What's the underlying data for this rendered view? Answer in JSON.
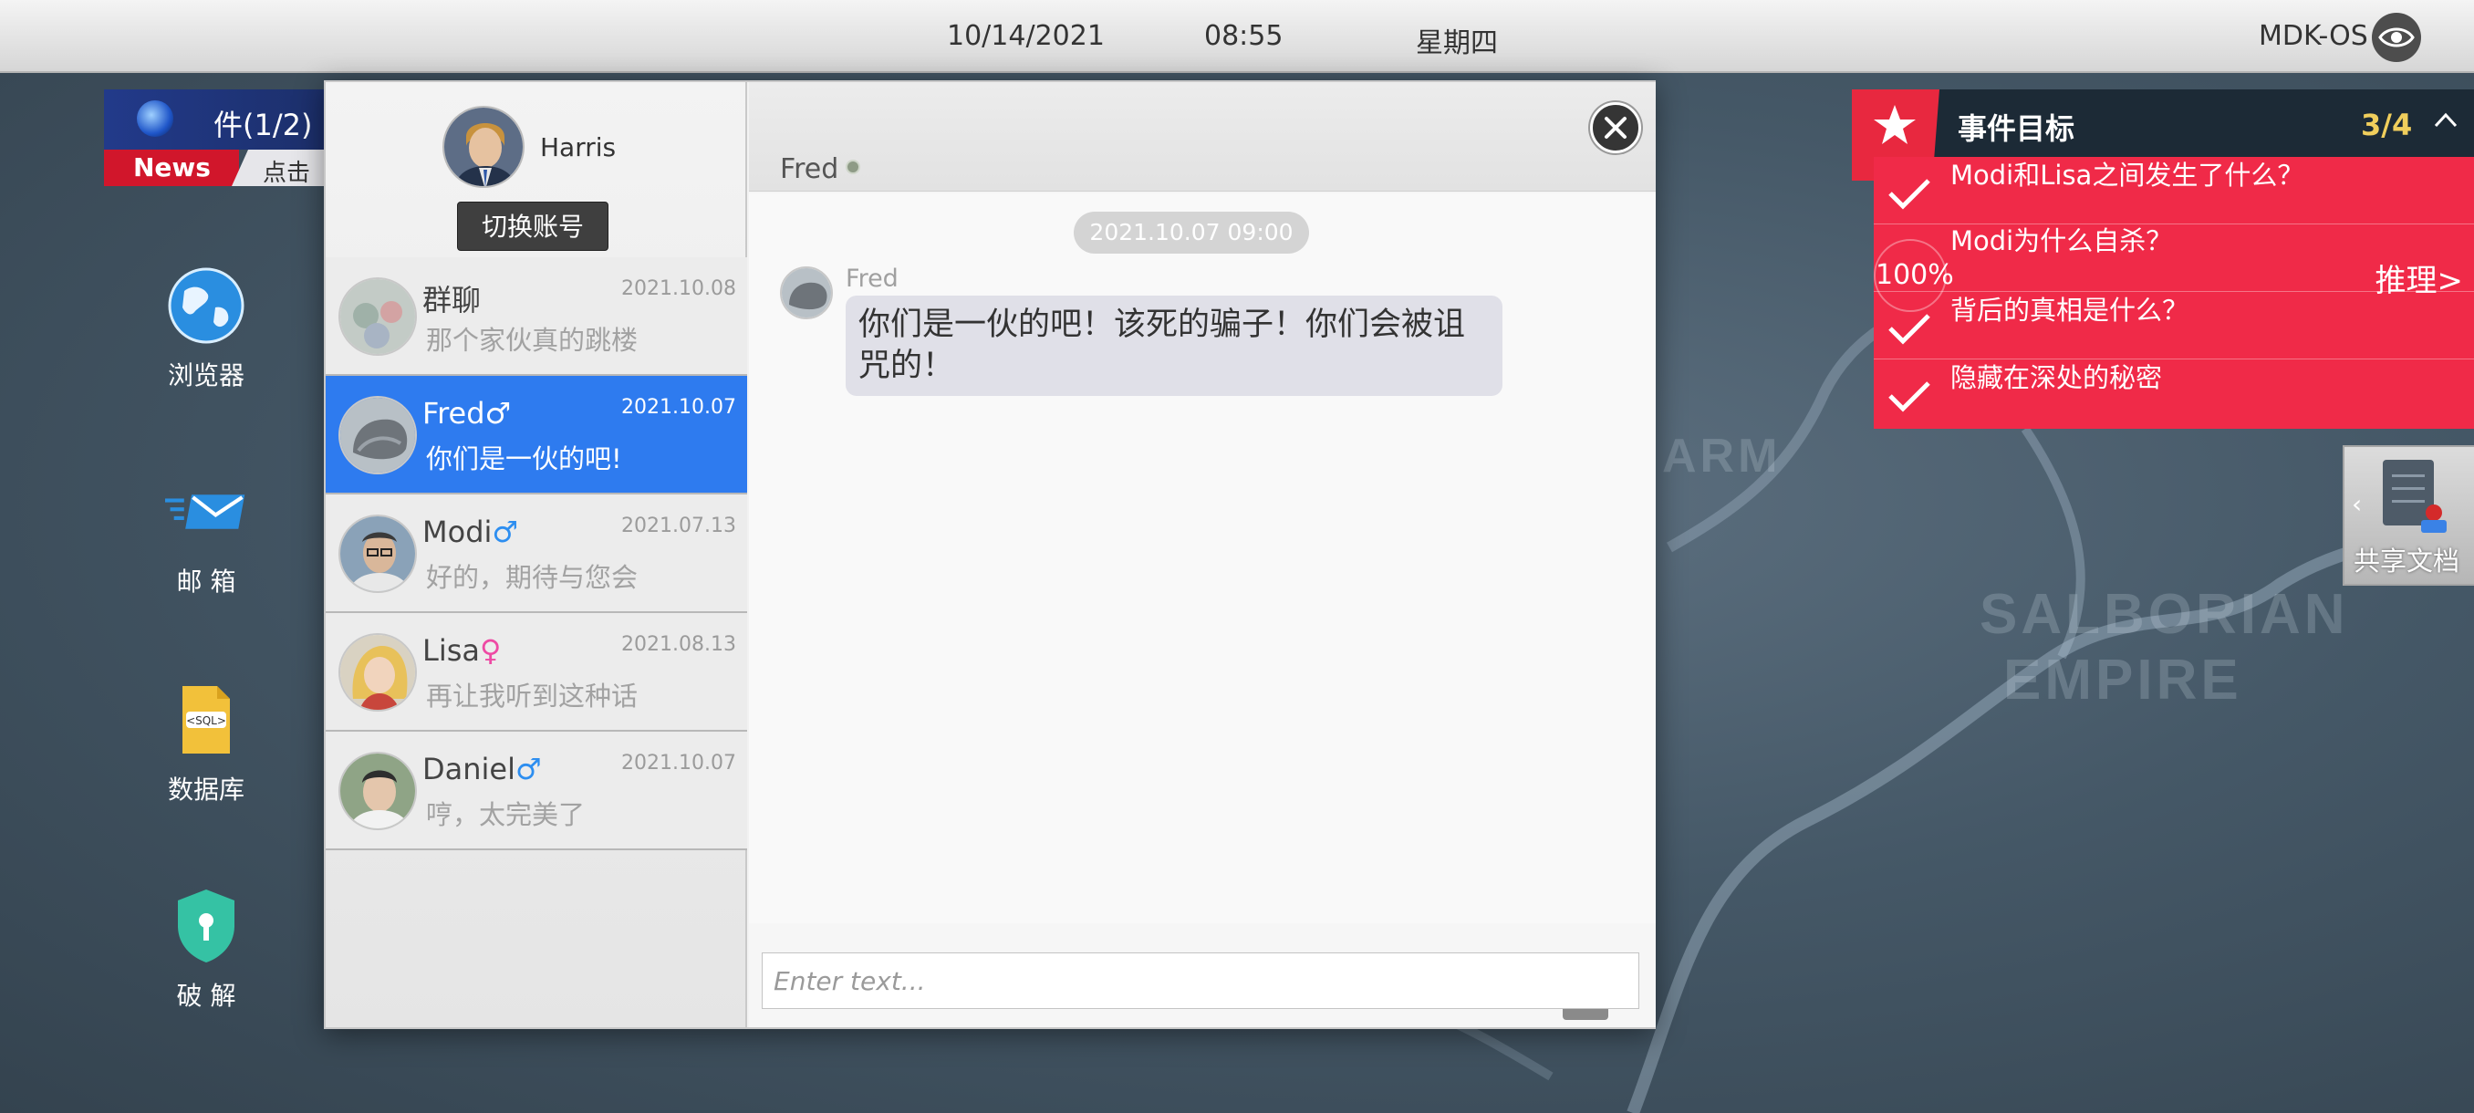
{
  "topbar": {
    "date": "10/14/2021",
    "time": "08:55",
    "weekday": "星期四",
    "os_name": "MDK-OS"
  },
  "news": {
    "title": "件(1/2)",
    "label": "News",
    "hint": "点击"
  },
  "desktop": {
    "browser": "浏览器",
    "mail": "邮 箱",
    "database": "数据库",
    "crack": "破 解"
  },
  "account": {
    "name": "Harris",
    "switch_label": "切换账号"
  },
  "conversations": [
    {
      "name": "群聊",
      "gender": "",
      "date": "2021.10.08",
      "preview": "那个家伙真的跳楼"
    },
    {
      "name": "Fred",
      "gender": "♂",
      "date": "2021.10.07",
      "preview": "你们是一伙的吧!"
    },
    {
      "name": "Modi",
      "gender": "♂",
      "date": "2021.07.13",
      "preview": "好的，期待与您会"
    },
    {
      "name": "Lisa",
      "gender": "♀",
      "date": "2021.08.13",
      "preview": "再让我听到这种话"
    },
    {
      "name": "Daniel",
      "gender": "♂",
      "date": "2021.10.07",
      "preview": "哼，太完美了"
    }
  ],
  "chat": {
    "partner": "Fred",
    "timestamp": "2021.10.07  09:00",
    "messages": [
      {
        "sender": "Fred",
        "text": "你们是一伙的吧！该死的骗子！你们会被诅咒的！"
      }
    ],
    "input_placeholder": "Enter text..."
  },
  "events": {
    "title": "事件目标",
    "count": "3/4",
    "items": [
      {
        "text": "Modi和Lisa之间发生了什么？",
        "done": true
      },
      {
        "text": "Modi为什么自杀？",
        "done": false,
        "progress": "100%"
      },
      {
        "text": "背后的真相是什么？",
        "done": true
      },
      {
        "text": "隐藏在深处的秘密",
        "done": true
      }
    ],
    "reason_label": "推理>"
  },
  "shared_doc": {
    "label": "共享文档"
  },
  "map_labels": {
    "arm": "ARM",
    "salborian": "SALBORIAN",
    "empire": "EMPIRE"
  },
  "colors": {
    "accent_blue": "#2e7bef",
    "events_red": "#f02a48",
    "events_header": "#1c2a36",
    "count_yellow": "#f0ce5c"
  }
}
